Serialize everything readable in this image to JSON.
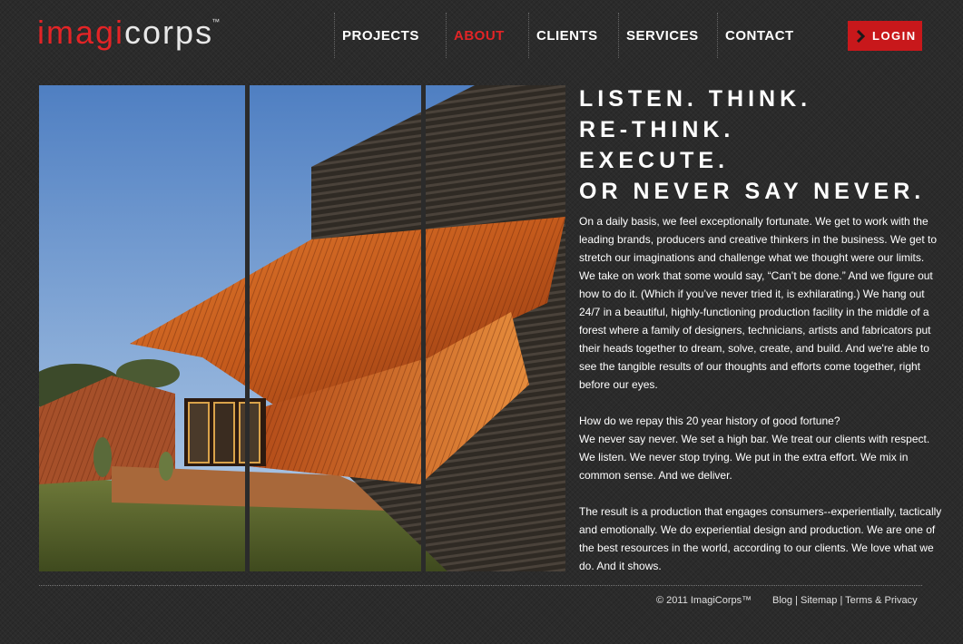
{
  "brand": {
    "logo_part1": "imagi",
    "logo_part2": "corps",
    "tm": "™"
  },
  "nav": {
    "items": [
      {
        "label": "PROJECTS",
        "active": false
      },
      {
        "label": "ABOUT",
        "active": true
      },
      {
        "label": "CLIENTS",
        "active": false
      },
      {
        "label": "SERVICES",
        "active": false
      },
      {
        "label": "CONTACT",
        "active": false
      }
    ],
    "login_label": "LOGIN"
  },
  "hero": {
    "headline_lines": [
      "LISTEN. THINK.",
      "RE-THINK.",
      "EXECUTE.",
      "OR NEVER SAY NEVER."
    ]
  },
  "body": {
    "paragraphs": [
      "On a daily basis, we feel exceptionally fortunate. We get to work with the leading brands, producers and creative thinkers in the business. We get to stretch our imaginations and challenge what we thought were our limits. We take on work that some would say, “Can’t be done.” And we figure out how to do it. (Which if you’ve never tried it, is exhilarating.) We hang out 24/7 in a beautiful, highly-functioning production facility in the middle of a forest where a family of designers, technicians, artists and fabricators put their heads together to dream, solve, create, and build. And we're able to see the tangible results of our thoughts and efforts come together, right before our eyes.",
      "How do we repay this 20 year history of good fortune?",
      "We never say never. We set a high bar. We treat our clients with respect. We listen. We never stop trying. We put in the extra effort. We mix in common sense. And we deliver.",
      "The result is a production that engages consumers--experientially, tactically and emotionally. We do experiential design and production. We are one of the best resources in the world, according to our clients. We love what we do. And it shows."
    ]
  },
  "footer": {
    "copyright": "© 2011 ImagiCorps™",
    "links": [
      "Blog",
      "Sitemap",
      "Terms & Privacy"
    ],
    "separator": "|"
  },
  "colors": {
    "accent": "#e32426",
    "background": "#2b2b2b",
    "login_bg": "#c8181b"
  }
}
